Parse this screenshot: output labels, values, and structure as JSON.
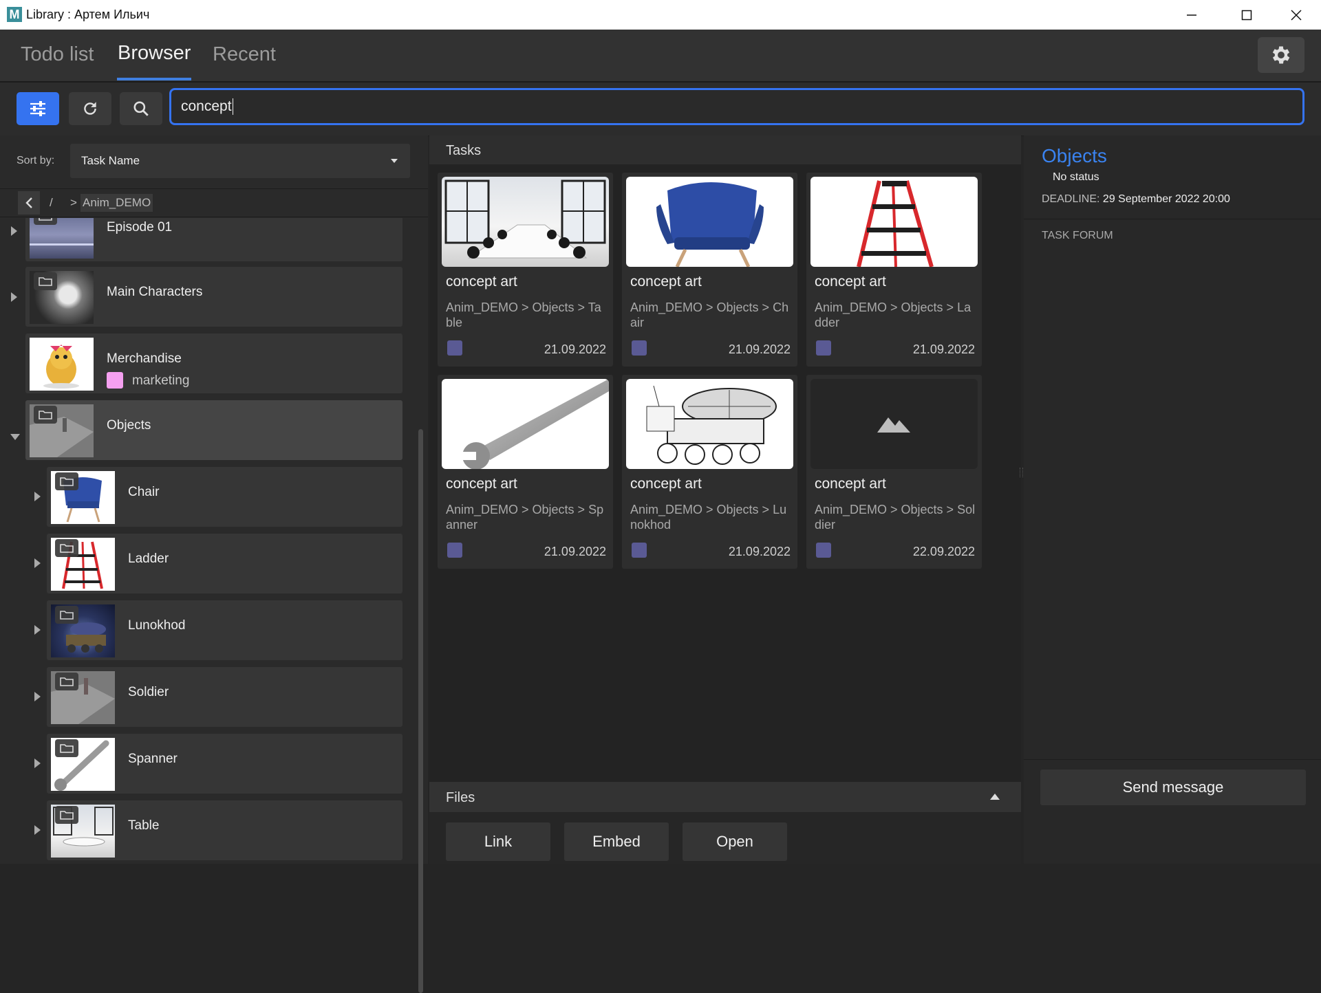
{
  "window": {
    "title": "Library : Артем Ильич",
    "app_icon_letter": "M"
  },
  "nav": {
    "tabs": [
      "Todo list",
      "Browser",
      "Recent"
    ],
    "active_tab": "Browser"
  },
  "search": {
    "value": "concept"
  },
  "sort": {
    "label": "Sort by:",
    "value": "Task Name"
  },
  "breadcrumb": {
    "root": "/",
    "separator": ">",
    "current": "Anim_DEMO"
  },
  "tree": {
    "episode": "Episode 01",
    "main_characters": "Main Characters",
    "merchandise": "Merchandise",
    "merch_tag": "marketing",
    "merch_tag_color": "#f5a0f0",
    "objects": "Objects",
    "chair": "Chair",
    "ladder": "Ladder",
    "lunokhod": "Lunokhod",
    "soldier": "Soldier",
    "spanner": "Spanner",
    "table": "Table"
  },
  "tasks": {
    "header": "Tasks",
    "cards": [
      {
        "title": "concept art",
        "path": "Anim_DEMO > Objects > Table",
        "date": "21.09.2022"
      },
      {
        "title": "concept art",
        "path": "Anim_DEMO > Objects > Chair",
        "date": "21.09.2022"
      },
      {
        "title": "concept art",
        "path": "Anim_DEMO > Objects > Ladder",
        "date": "21.09.2022"
      },
      {
        "title": "concept art",
        "path": "Anim_DEMO > Objects > Spanner",
        "date": "21.09.2022"
      },
      {
        "title": "concept art",
        "path": "Anim_DEMO > Objects > Lunokhod",
        "date": "21.09.2022"
      },
      {
        "title": "concept art",
        "path": "Anim_DEMO > Objects > Soldier",
        "date": "22.09.2022"
      }
    ],
    "status_color": "#5a5a94"
  },
  "files": {
    "header": "Files",
    "buttons": [
      "Link",
      "Embed",
      "Open"
    ]
  },
  "details": {
    "title": "Objects",
    "status": "No status",
    "deadline_label": "DEADLINE:",
    "deadline_value": "29 September 2022 20:00",
    "forum_label": "TASK FORUM",
    "send_label": "Send message"
  },
  "colors": {
    "accent": "#3573f0",
    "title_accent": "#3a83f0"
  }
}
